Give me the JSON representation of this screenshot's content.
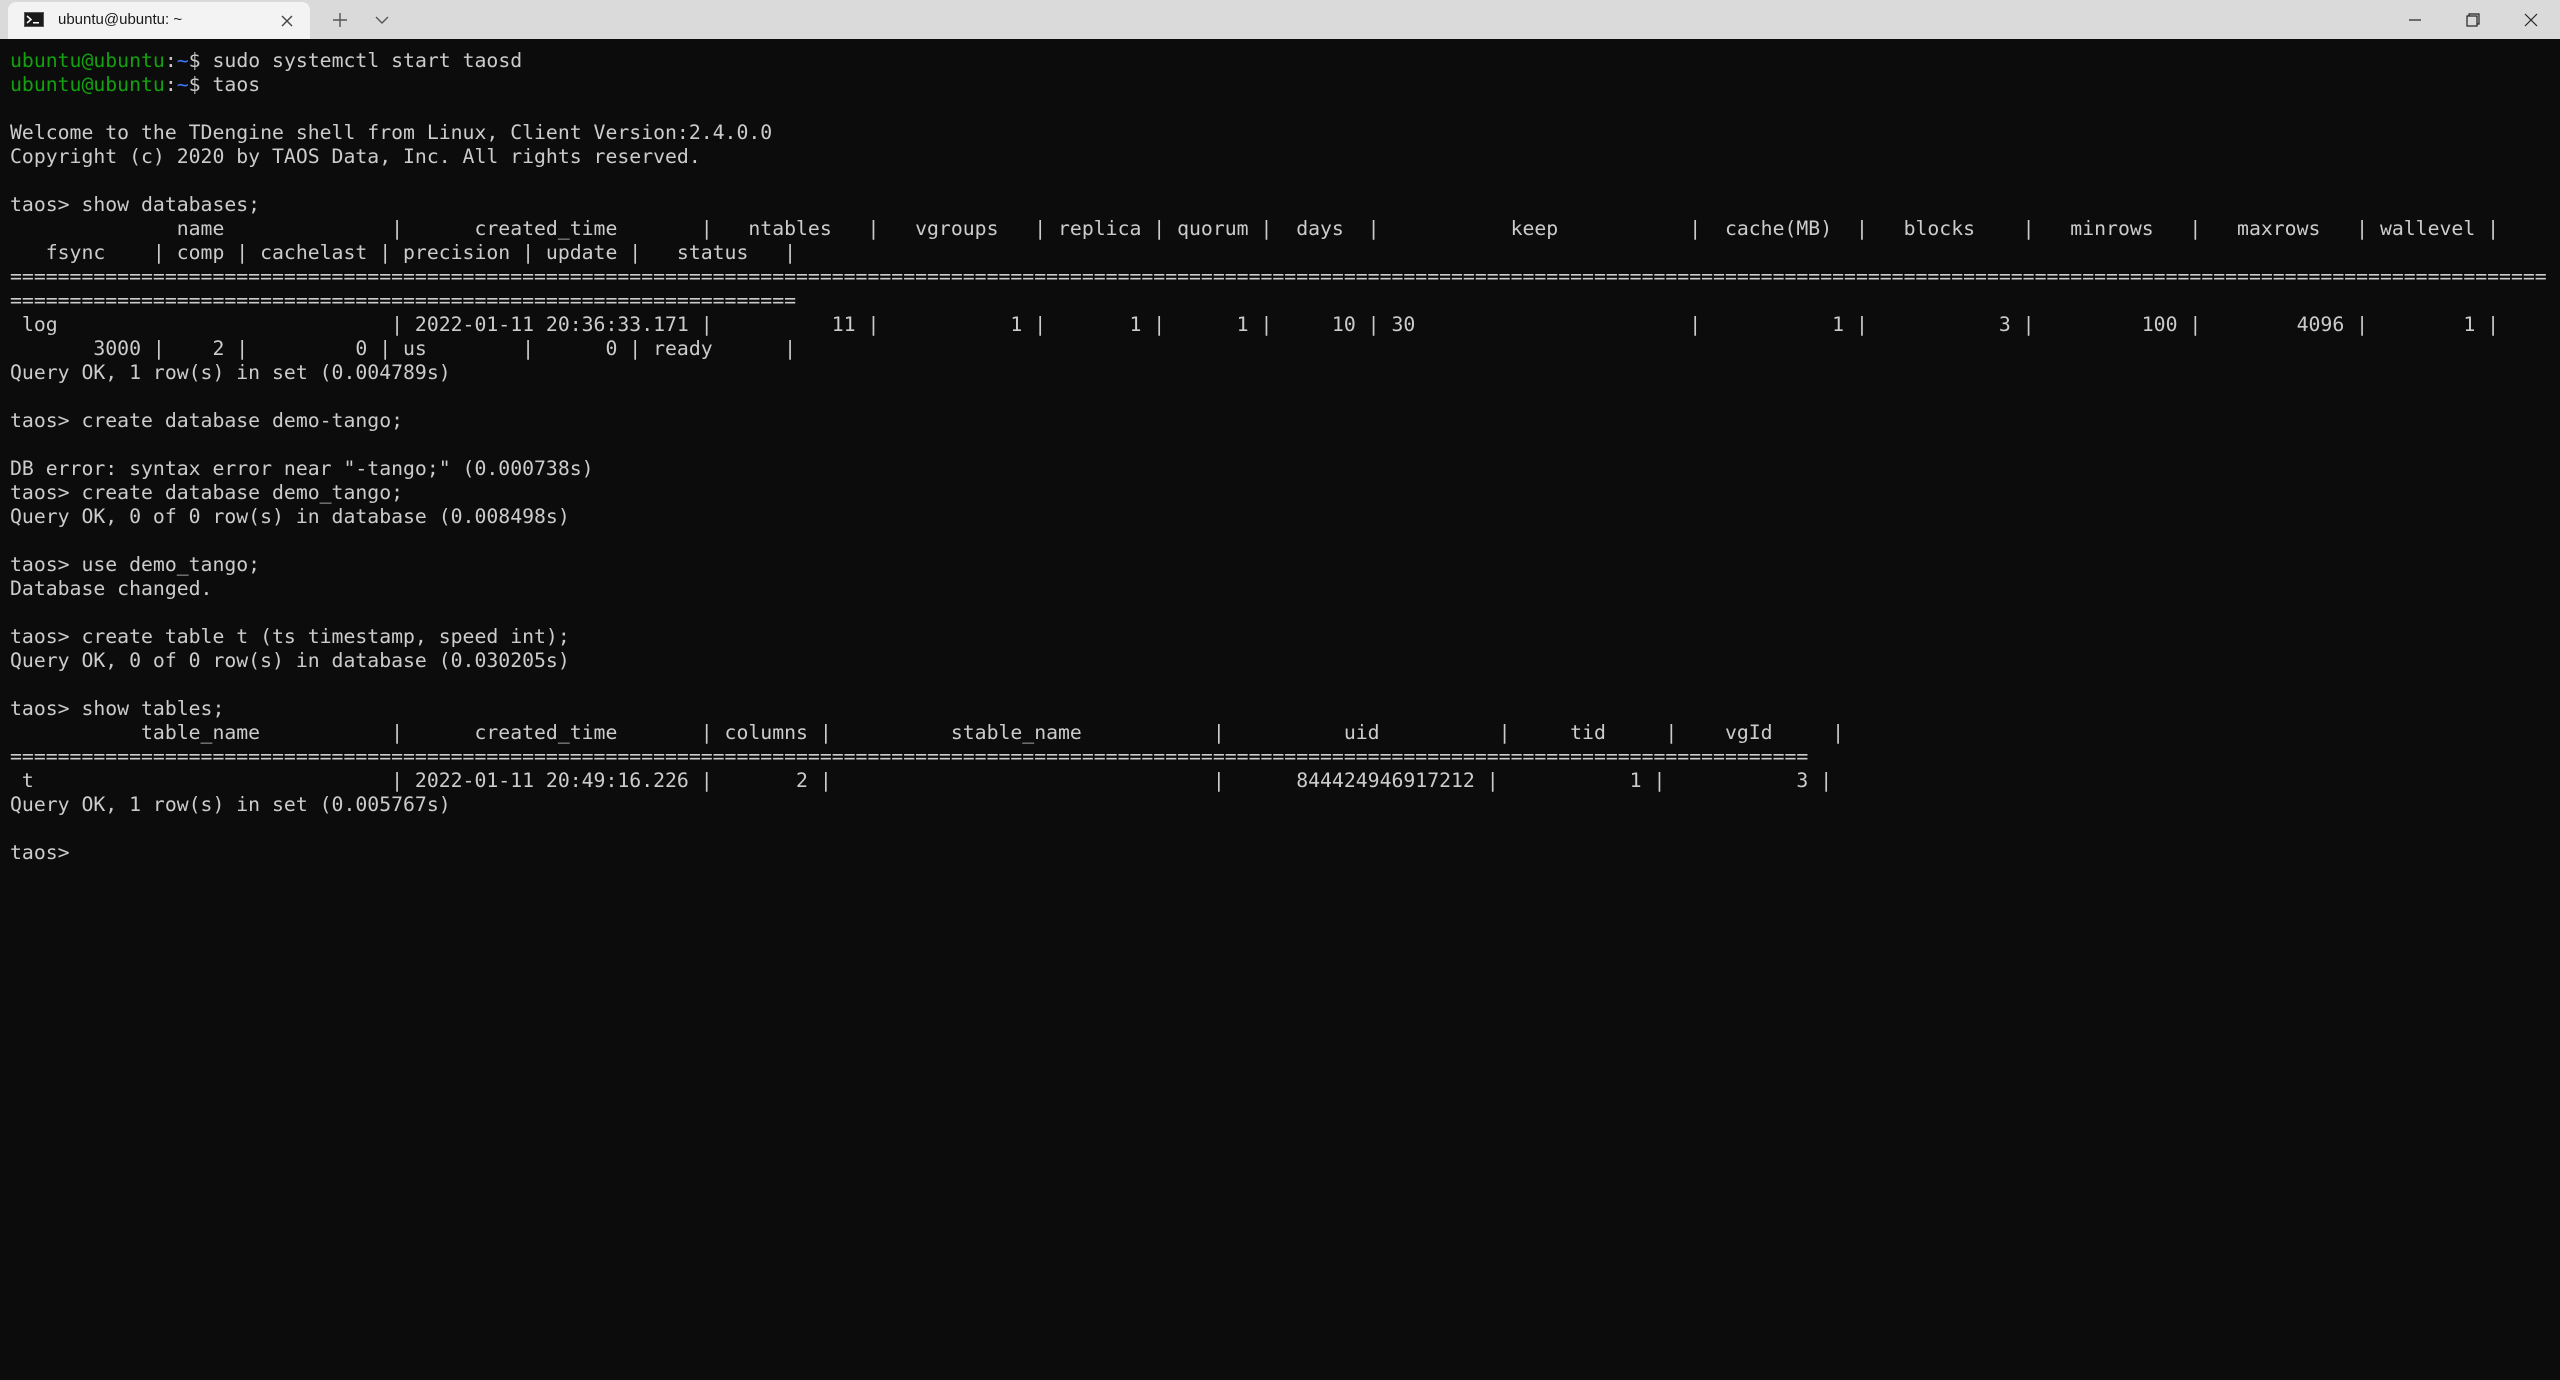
{
  "window": {
    "tab_title": "ubuntu@ubuntu: ~",
    "icons": {
      "tab": "terminal-icon",
      "close_tab": "close-icon",
      "new_tab": "plus-icon",
      "dropdown": "chevron-down-icon",
      "minimize": "minimize-icon",
      "restore": "restore-icon",
      "close": "close-icon"
    }
  },
  "colors": {
    "background": "#0c0c0c",
    "foreground": "#cccccc",
    "prompt_user": "#13a10e",
    "prompt_path": "#3b78ff",
    "titlebar": "#dadada",
    "tab": "#f3f3f3"
  },
  "terminal": {
    "lines": [
      {
        "type": "prompt",
        "user": "ubuntu@ubuntu",
        "path": "~",
        "cmd": " sudo systemctl start taosd"
      },
      {
        "type": "prompt",
        "user": "ubuntu@ubuntu",
        "path": "~",
        "cmd": " taos"
      },
      {
        "type": "text",
        "text": ""
      },
      {
        "type": "text",
        "text": "Welcome to the TDengine shell from Linux, Client Version:2.4.0.0"
      },
      {
        "type": "text",
        "text": "Copyright (c) 2020 by TAOS Data, Inc. All rights reserved."
      },
      {
        "type": "text",
        "text": ""
      },
      {
        "type": "text",
        "text": "taos> show databases;"
      },
      {
        "type": "text",
        "text": "              name              |      created_time       |   ntables   |   vgroups   | replica | quorum |  days  |           keep           |  cache(MB)  |   blocks    |   minrows   |   maxrows   | wallevel |"
      },
      {
        "type": "text",
        "text": "   fsync    | comp | cachelast | precision | update |   status   |"
      },
      {
        "type": "text",
        "text": "====================================================================================================================================================================================================================="
      },
      {
        "type": "text",
        "text": "=================================================================="
      },
      {
        "type": "text",
        "text": " log                            | 2022-01-11 20:36:33.171 |          11 |           1 |       1 |      1 |     10 | 30                       |           1 |           3 |         100 |        4096 |        1 |"
      },
      {
        "type": "text",
        "text": "       3000 |    2 |         0 | us        |      0 | ready      |"
      },
      {
        "type": "text",
        "text": "Query OK, 1 row(s) in set (0.004789s)"
      },
      {
        "type": "text",
        "text": ""
      },
      {
        "type": "text",
        "text": "taos> create database demo-tango;"
      },
      {
        "type": "text",
        "text": ""
      },
      {
        "type": "text",
        "text": "DB error: syntax error near \"-tango;\" (0.000738s)"
      },
      {
        "type": "text",
        "text": "taos> create database demo_tango;"
      },
      {
        "type": "text",
        "text": "Query OK, 0 of 0 row(s) in database (0.008498s)"
      },
      {
        "type": "text",
        "text": ""
      },
      {
        "type": "text",
        "text": "taos> use demo_tango;"
      },
      {
        "type": "text",
        "text": "Database changed."
      },
      {
        "type": "text",
        "text": ""
      },
      {
        "type": "text",
        "text": "taos> create table t (ts timestamp, speed int);"
      },
      {
        "type": "text",
        "text": "Query OK, 0 of 0 row(s) in database (0.030205s)"
      },
      {
        "type": "text",
        "text": ""
      },
      {
        "type": "text",
        "text": "taos> show tables;"
      },
      {
        "type": "text",
        "text": "           table_name           |      created_time       | columns |          stable_name           |          uid          |     tid     |    vgId     |"
      },
      {
        "type": "text",
        "text": "======================================================================================================================================================="
      },
      {
        "type": "text",
        "text": " t                              | 2022-01-11 20:49:16.226 |       2 |                                |      844424946917212 |           1 |           3 |"
      },
      {
        "type": "text",
        "text": "Query OK, 1 row(s) in set (0.005767s)"
      },
      {
        "type": "text",
        "text": ""
      },
      {
        "type": "text",
        "text": "taos> "
      }
    ]
  }
}
